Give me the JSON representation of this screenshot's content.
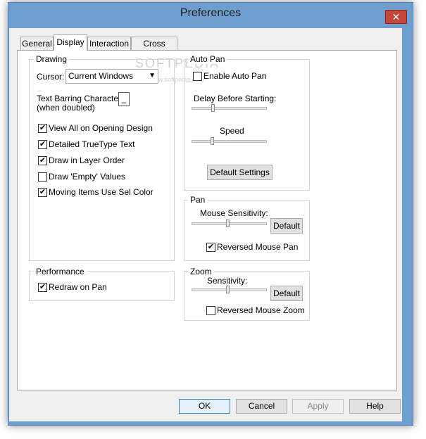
{
  "window": {
    "title": "Preferences",
    "close_glyph": "✕"
  },
  "tabs": [
    {
      "label": "General"
    },
    {
      "label": "Display"
    },
    {
      "label": "Interaction"
    },
    {
      "label": "Cross Probe"
    }
  ],
  "watermark": {
    "main": "SOFTPEDIA",
    "sub": "www.softpedia.com"
  },
  "drawing": {
    "group_label": "Drawing",
    "cursor_label": "Cursor:",
    "cursor_value": "Current Windows",
    "text_barring_label": "Text Barring Character:",
    "text_barring_sub": "(when doubled)",
    "text_barring_value": "_",
    "options": [
      {
        "label": "View All on Opening Design",
        "checked": true
      },
      {
        "label": "Detailed TrueType Text",
        "checked": true
      },
      {
        "label": "Draw in Layer Order",
        "checked": true
      },
      {
        "label": "Draw 'Empty' Values",
        "checked": false
      },
      {
        "label": "Moving Items Use Sel Color",
        "checked": true
      }
    ]
  },
  "performance": {
    "group_label": "Performance",
    "redraw_on_pan": {
      "label": "Redraw on Pan",
      "checked": true
    }
  },
  "auto_pan": {
    "group_label": "Auto Pan",
    "enable": {
      "label": "Enable Auto Pan",
      "checked": false
    },
    "delay_label": "Delay Before Starting:",
    "delay_level": 0.28,
    "speed_label": "Speed",
    "speed_level": 0.27,
    "default_settings_label": "Default Settings"
  },
  "pan": {
    "group_label": "Pan",
    "sensitivity_label": "Mouse Sensitivity:",
    "sensitivity_level": 0.48,
    "default_label": "Default",
    "reversed": {
      "label": "Reversed Mouse Pan",
      "checked": true
    }
  },
  "zoom": {
    "group_label": "Zoom",
    "sensitivity_label": "Sensitivity:",
    "sensitivity_level": 0.48,
    "default_label": "Default",
    "reversed": {
      "label": "Reversed Mouse Zoom",
      "checked": false
    }
  },
  "footer": {
    "ok_label": "OK",
    "cancel_label": "Cancel",
    "apply_label": "Apply",
    "help_label": "Help"
  }
}
